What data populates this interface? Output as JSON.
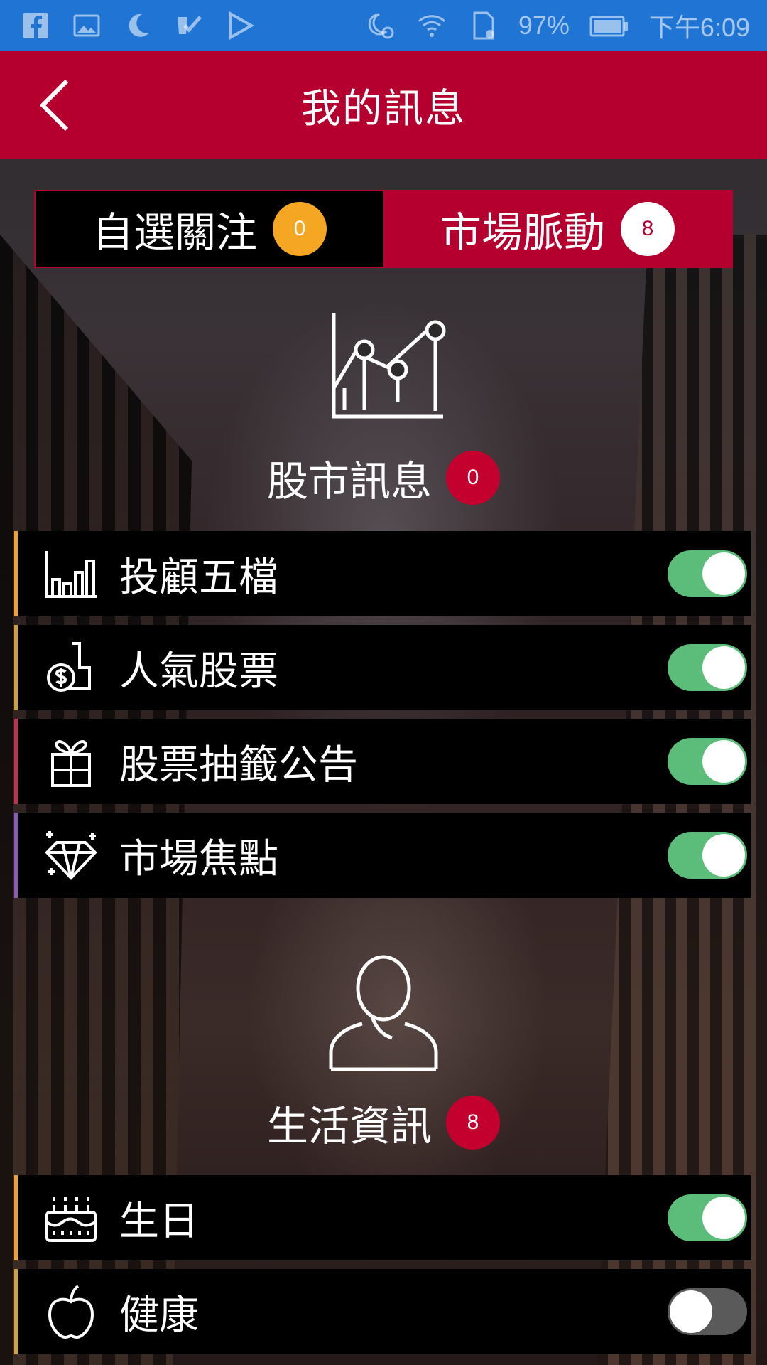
{
  "status_bar": {
    "battery": "97%",
    "time": "下午6:09"
  },
  "header": {
    "title": "我的訊息"
  },
  "tabs": [
    {
      "label": "自選關注",
      "count": "0",
      "active": false
    },
    {
      "label": "市場脈動",
      "count": "8",
      "active": true
    }
  ],
  "sections": [
    {
      "title": "股市訊息",
      "count": "0",
      "icon": "chart-icon",
      "items": [
        {
          "label": "投顧五檔",
          "icon": "bar-chart-icon",
          "enabled": true,
          "accent": "#f0a030"
        },
        {
          "label": "人氣股票",
          "icon": "money-hand-icon",
          "enabled": true,
          "accent": "#d0a040"
        },
        {
          "label": "股票抽籤公告",
          "icon": "gift-icon",
          "enabled": true,
          "accent": "#c03050"
        },
        {
          "label": "市場焦點",
          "icon": "diamond-icon",
          "enabled": true,
          "accent": "#8a5ab8"
        }
      ]
    },
    {
      "title": "生活資訊",
      "count": "8",
      "icon": "person-icon",
      "items": [
        {
          "label": "生日",
          "icon": "cake-icon",
          "enabled": true,
          "accent": "#f0a030"
        },
        {
          "label": "健康",
          "icon": "apple-icon",
          "enabled": false,
          "accent": "#d0a040"
        }
      ]
    }
  ],
  "colors": {
    "primary": "#b5002f",
    "status_bar": "#1f74d4",
    "toggle_on": "#5cbd7a",
    "badge_orange": "#f5a623"
  }
}
